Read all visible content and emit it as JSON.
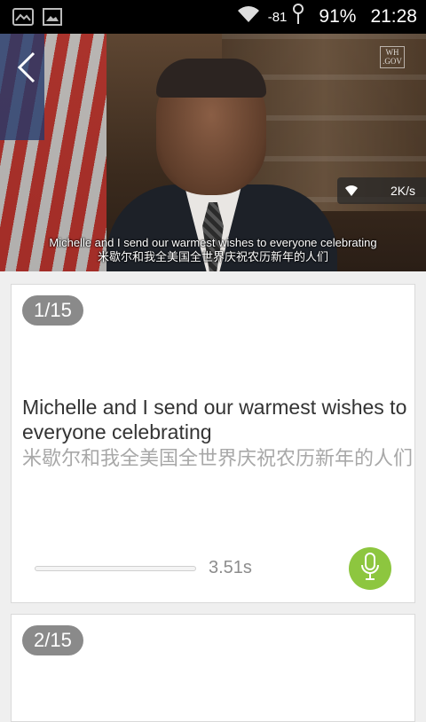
{
  "status_bar": {
    "signal": "-81",
    "battery": "91%",
    "time": "21:28"
  },
  "video": {
    "badge_text": "WH .GOV",
    "speed": "2K/s",
    "subtitle_en": "Michelle and I send our warmest wishes to everyone celebrating",
    "subtitle_zh": "米歇尔和我全美国全世界庆祝农历新年的人们"
  },
  "cards": [
    {
      "index": "1/15",
      "sentence_en": "Michelle and I send our warmest wishes to everyone celebrating",
      "sentence_zh": "米歇尔和我全美国全世界庆祝农历新年的人们",
      "duration": "3.51s"
    },
    {
      "index": "2/15"
    }
  ],
  "colors": {
    "mic_button": "#8dc63f",
    "badge": "#8a8a8a",
    "background": "#efefef"
  },
  "icons": [
    "image-icon",
    "photo-icon",
    "wifi-icon",
    "signal-icon",
    "back-arrow-icon",
    "microphone-icon"
  ]
}
